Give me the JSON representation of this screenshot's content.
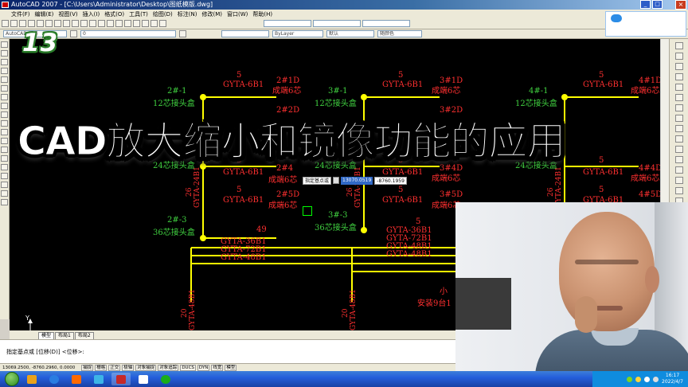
{
  "window": {
    "title": "AutoCAD 2007 - [C:\\Users\\Administrator\\Desktop\\图纸模版.dwg]",
    "min": "_",
    "max": "□",
    "close": "×"
  },
  "menu": [
    "文件(F)",
    "编辑(E)",
    "视图(V)",
    "插入(I)",
    "格式(O)",
    "工具(T)",
    "绘图(D)",
    "标注(N)",
    "修改(M)",
    "窗口(W)",
    "帮助(H)"
  ],
  "toolbar2": {
    "workspace": "AutoCAD 经典",
    "layer": "0",
    "linetype": "ByLayer",
    "lineweight": "默认",
    "color": "随颜色"
  },
  "overlay": {
    "episode": "13",
    "title": "CAD放大缩小和镜像功能的应用"
  },
  "drawing": {
    "left": {
      "box1_id": "2#-1",
      "box1_name": "12芯接头盒",
      "box2_name": "24芯接头盒",
      "box3_id": "2#-3",
      "box3_name": "36芯接头盒",
      "cable": "GYTA-6B1",
      "count": "5",
      "e1_id": "2#1D",
      "e1_name": "成端6芯",
      "e2_id": "2#2D",
      "e2_name": "成端6芯",
      "e4_name": "成端6芯",
      "e5_id": "2#5D",
      "e5_name": "成端6芯",
      "v26": "26",
      "vcable": "GYTA-24B1",
      "trunk_count": "49",
      "t1": "GYTA-36B1",
      "t2": "GYTA-72B1",
      "t3": "GYTA-48B1",
      "bottom_count": "20",
      "bottom_cable": "GYTA-48B1"
    },
    "mid": {
      "box1_id": "3#-1",
      "box1_name": "12芯接头盒",
      "box2_name": "24芯接头盒",
      "box3_id": "3#-3",
      "box3_name": "36芯接头盒",
      "cable": "GYTA-6B1",
      "count": "5",
      "e1_id": "3#1D",
      "e1_name": "成端6芯",
      "e2_id": "3#2D",
      "e2_name": "成端6芯",
      "e4_id": "3#4D",
      "e4_name": "成端6芯",
      "e5_id": "3#5D",
      "e5_name": "成端6芯",
      "v26": "26",
      "vcable": "GYTA-24B1",
      "t1": "GYTA-36B1",
      "t2": "GYTA-72B1",
      "t3": "GYTA-48B1",
      "t4": "GYTA-48B1",
      "bottom_count": "20",
      "bottom_cable": "GYTA-48B1",
      "note1": "小",
      "note2": "安装9台1"
    },
    "right": {
      "box1_id": "4#-1",
      "box1_name": "12芯接头盒",
      "box2_name": "24芯接头盒",
      "cable": "GYTA-6B1",
      "count": "5",
      "e1_id": "4#1D",
      "e1_name": "成端6芯",
      "e2_name": "成端6芯",
      "e4_id": "4#4D",
      "e4_name": "成端6芯",
      "e5_id": "4#5D",
      "v26": "26",
      "vcable": "GYTA-24B1"
    },
    "partial_label": "2#4",
    "ucs_y": "Y",
    "ucs_x": "X"
  },
  "coord_input": {
    "prompt": "指定基点或",
    "x_value": "13070.0519",
    "y_value": "-8760.1959"
  },
  "layout_tabs": [
    "模型",
    "布局1",
    "布局2"
  ],
  "command": {
    "line1": "",
    "line2": "指定基点或 [位移(D)] <位移>:"
  },
  "status": {
    "coords": "13069.2500, -8760.2960, 0.0000",
    "buttons": [
      "捕捉",
      "栅格",
      "正交",
      "极轴",
      "对象捕捉",
      "对象追踪",
      "DUCS",
      "DYN",
      "线宽",
      "模型"
    ]
  },
  "taskbar": {
    "time": "16:17",
    "date": "2022/4/7"
  }
}
